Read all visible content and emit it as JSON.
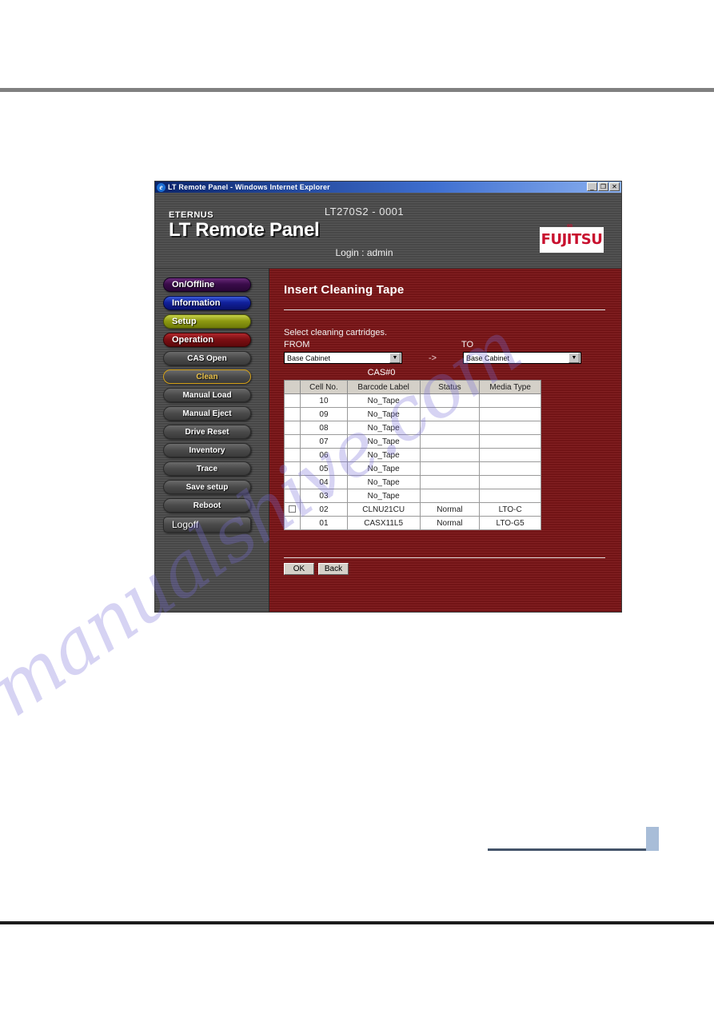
{
  "window": {
    "title": "LT Remote Panel - Windows Internet Explorer",
    "icon": "internet-explorer-icon",
    "minimize": "_",
    "maximize": "❐",
    "close": "✕"
  },
  "header": {
    "brand_small": "ETERNUS",
    "brand_title": "LT Remote Panel",
    "unit_id": "LT270S2 - 0001",
    "login": "Login : admin",
    "logo_text": "FUJITSU",
    "logo_mark": "∞"
  },
  "sidebar": {
    "primary": [
      {
        "label": "On/Offline",
        "style": "nav-onoffline"
      },
      {
        "label": "Information",
        "style": "nav-information"
      },
      {
        "label": "Setup",
        "style": "nav-setup"
      },
      {
        "label": "Operation",
        "style": "nav-operation"
      }
    ],
    "sub": [
      {
        "label": "CAS Open",
        "active": false
      },
      {
        "label": "Clean",
        "active": true
      },
      {
        "label": "Manual Load",
        "active": false
      },
      {
        "label": "Manual Eject",
        "active": false
      },
      {
        "label": "Drive Reset",
        "active": false
      },
      {
        "label": "Inventory",
        "active": false
      },
      {
        "label": "Trace",
        "active": false
      },
      {
        "label": "Save setup",
        "active": false
      },
      {
        "label": "Reboot",
        "active": false
      }
    ],
    "logoff": "Logoff"
  },
  "content": {
    "page_title": "Insert Cleaning Tape",
    "instruction": "Select cleaning cartridges.",
    "from_label": "FROM",
    "to_label": "TO",
    "from_value": "Base Cabinet",
    "to_value": "Base Cabinet",
    "transfer_arrow": "->",
    "cas_label": "CAS#0",
    "table": {
      "columns": [
        "",
        "Cell No.",
        "Barcode Label",
        "Status",
        "Media Type"
      ],
      "rows": [
        {
          "checkbox": false,
          "has_checkbox": false,
          "cell": "10",
          "barcode": "No_Tape",
          "status": "",
          "media": ""
        },
        {
          "checkbox": false,
          "has_checkbox": false,
          "cell": "09",
          "barcode": "No_Tape",
          "status": "",
          "media": ""
        },
        {
          "checkbox": false,
          "has_checkbox": false,
          "cell": "08",
          "barcode": "No_Tape",
          "status": "",
          "media": ""
        },
        {
          "checkbox": false,
          "has_checkbox": false,
          "cell": "07",
          "barcode": "No_Tape",
          "status": "",
          "media": ""
        },
        {
          "checkbox": false,
          "has_checkbox": false,
          "cell": "06",
          "barcode": "No_Tape",
          "status": "",
          "media": ""
        },
        {
          "checkbox": false,
          "has_checkbox": false,
          "cell": "05",
          "barcode": "No_Tape",
          "status": "",
          "media": ""
        },
        {
          "checkbox": false,
          "has_checkbox": false,
          "cell": "04",
          "barcode": "No_Tape",
          "status": "",
          "media": ""
        },
        {
          "checkbox": false,
          "has_checkbox": false,
          "cell": "03",
          "barcode": "No_Tape",
          "status": "",
          "media": ""
        },
        {
          "checkbox": false,
          "has_checkbox": true,
          "cell": "02",
          "barcode": "CLNU21CU",
          "status": "Normal",
          "media": "LTO-C"
        },
        {
          "checkbox": false,
          "has_checkbox": false,
          "cell": "01",
          "barcode": "CASX11L5",
          "status": "Normal",
          "media": "LTO-G5"
        }
      ]
    },
    "ok_label": "OK",
    "back_label": "Back"
  },
  "page": {
    "watermark": "manualshive.com"
  },
  "colors": {
    "content_red": "#7d1618",
    "chrome_gray": "#4d4d4d",
    "fujitsu_red": "#c8102e",
    "active_nav": "#e8c04a"
  }
}
